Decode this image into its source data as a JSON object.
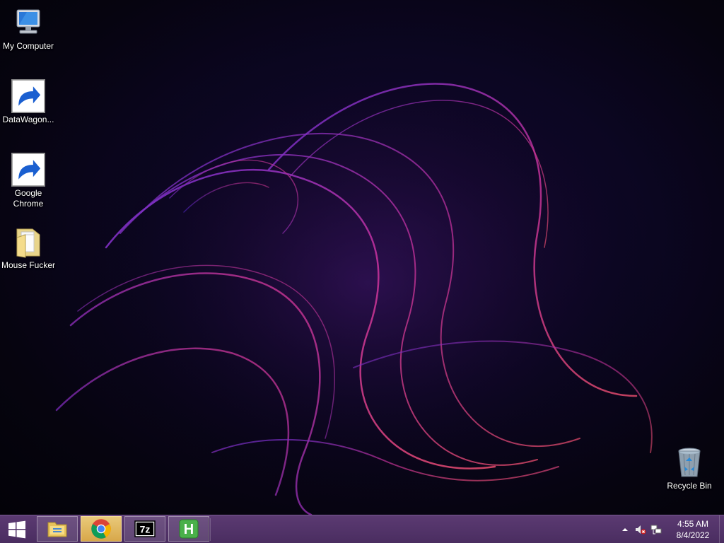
{
  "desktop": {
    "icons": [
      {
        "label": "My Computer",
        "icon": "computer-icon",
        "shortcut": false
      },
      {
        "label": "DataWagon...",
        "icon": "datawagon-icon",
        "shortcut": true
      },
      {
        "label": "Google Chrome",
        "icon": "chrome-icon",
        "shortcut": true
      },
      {
        "label": "Mouse Fucker",
        "icon": "folder-icon",
        "shortcut": false
      },
      {
        "label": "Recycle Bin",
        "icon": "recycle-bin-icon",
        "shortcut": false
      }
    ]
  },
  "taskbar": {
    "start": {
      "icon": "windows-logo-icon"
    },
    "pinned": [
      {
        "name": "File Explorer",
        "icon": "file-explorer-icon",
        "active": false
      },
      {
        "name": "Google Chrome",
        "icon": "chrome-icon",
        "active": true
      },
      {
        "name": "7-Zip",
        "icon": "7zip-icon",
        "label": "7z",
        "active": false
      },
      {
        "name": "H App",
        "icon": "h-app-icon",
        "label": "H",
        "active": false
      }
    ],
    "tray": {
      "icons": [
        "show-hidden-icons-chevron-icon",
        "speaker-muted-icon",
        "network-icon"
      ],
      "time": "4:55 AM",
      "date": "8/4/2022"
    }
  },
  "colors": {
    "taskbar": "#4a2d60",
    "active_task": "#d8a84a",
    "wallpaper_accent": "#b0309a"
  }
}
